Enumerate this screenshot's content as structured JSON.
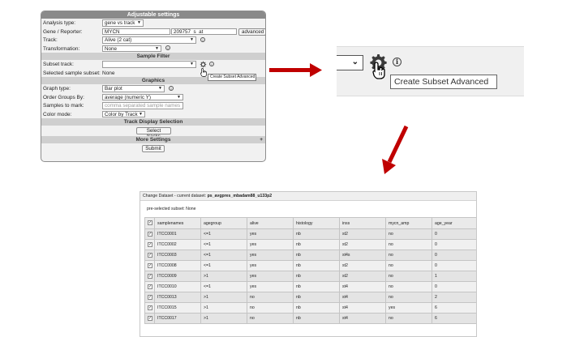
{
  "settings": {
    "title": "Adjustable settings",
    "analysis_type": {
      "label": "Analysis type:",
      "value": "gene vs track"
    },
    "gene_reporter": {
      "label": "Gene / Reporter:",
      "gene": "MYCN",
      "reporter": "209757_s_at",
      "advanced_label": "advanced"
    },
    "track": {
      "label": "Track:",
      "value": "Alive (2 cat)"
    },
    "transformation": {
      "label": "Transformation:",
      "value": "None"
    },
    "sample_filter": {
      "title": "Sample Filter",
      "subset_track_label": "Subset track:",
      "subset_track_value": "",
      "selected_subset_label": "Selected sample subset:",
      "selected_subset_value": "None",
      "tooltip": "Create Subset Advanced"
    },
    "graphics": {
      "title": "Graphics",
      "graph_type": {
        "label": "Graph type:",
        "value": "Bar plot"
      },
      "order_groups": {
        "label": "Order Groups By:",
        "value": "average (numeric Y)"
      },
      "samples_to_mark": {
        "label": "Samples to mark:",
        "placeholder": "comma separated sample names"
      },
      "color_mode": {
        "label": "Color mode:",
        "value": "Color by Track"
      }
    },
    "track_display": {
      "title": "Track Display Selection",
      "button": "Select tracks"
    },
    "more_settings": {
      "title": "More Settings",
      "toggle": "+"
    },
    "submit_label": "Submit"
  },
  "zoom": {
    "tooltip": "Create Subset Advanced",
    "info_glyph": "i",
    "icons": [
      "chevron-down-icon",
      "gear-icon",
      "hand-cursor-icon",
      "info-icon"
    ]
  },
  "subset": {
    "header_prefix": "Change Dataset - current dataset:",
    "dataset": "ps_avgpres_mbadam88_u133p2",
    "preselected": "pre-selected subset: None",
    "check_glyph": "✓",
    "columns": [
      "samplenames",
      "agegroup",
      "alive",
      "histology",
      "inss",
      "mycn_amp",
      "age_year"
    ],
    "rows": [
      [
        "ITCC0001",
        "<=1",
        "yes",
        "nb",
        "st2",
        "no",
        "0"
      ],
      [
        "ITCC0002",
        "<=1",
        "yes",
        "nb",
        "st2",
        "no",
        "0"
      ],
      [
        "ITCC0003",
        "<=1",
        "yes",
        "nb",
        "st4s",
        "no",
        "0"
      ],
      [
        "ITCC0008",
        "<=1",
        "yes",
        "nb",
        "st2",
        "no",
        "0"
      ],
      [
        "ITCC0009",
        ">1",
        "yes",
        "nb",
        "st2",
        "no",
        "1"
      ],
      [
        "ITCC0010",
        "<=1",
        "yes",
        "nb",
        "st4",
        "no",
        "0"
      ],
      [
        "ITCC0013",
        ">1",
        "no",
        "nb",
        "st4",
        "no",
        "2"
      ],
      [
        "ITCC0015",
        ">1",
        "no",
        "nb",
        "st4",
        "yes",
        "6"
      ],
      [
        "ITCC0017",
        ">1",
        "no",
        "nb",
        "st4",
        "no",
        "6"
      ]
    ]
  },
  "colors": {
    "arrow": "#c00000",
    "panel_header": "#8a8a8a",
    "section_header": "#cfcfcf"
  }
}
